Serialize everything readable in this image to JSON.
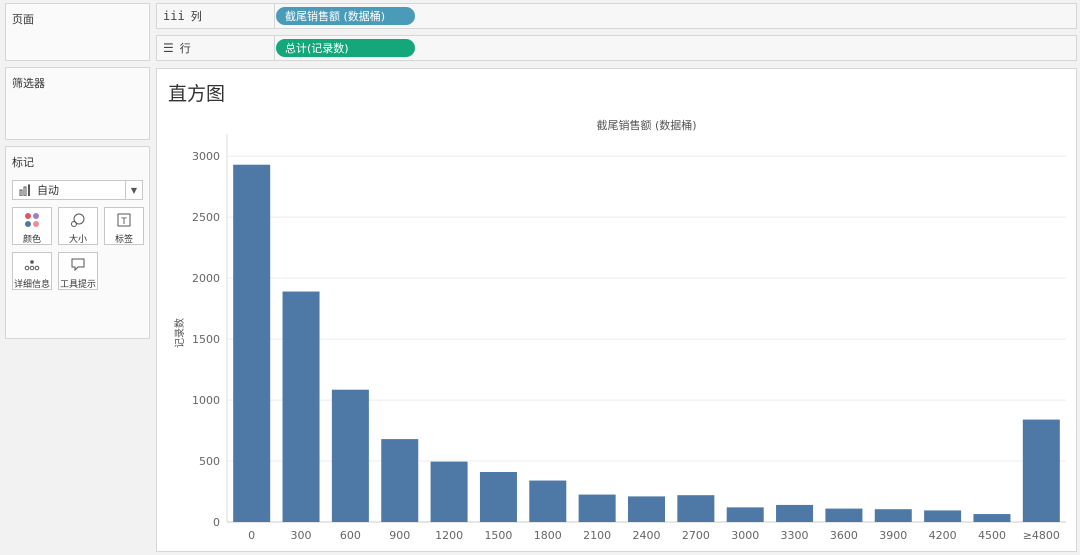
{
  "panels": {
    "pages": "页面",
    "filters": "筛选器",
    "marks": "标记"
  },
  "shelves": {
    "columns": {
      "icon": "iii",
      "label": "列",
      "pill": "截尾销售额 (数据桶)",
      "pill_color": "#4a9bb7"
    },
    "rows": {
      "icon": "☰",
      "label": "行",
      "pill": "总计(记录数)",
      "pill_color": "#14a77a"
    }
  },
  "marks_card": {
    "type": "自动",
    "buttons": [
      {
        "label": "颜色",
        "icon": "color-icon"
      },
      {
        "label": "大小",
        "icon": "size-icon"
      },
      {
        "label": "标签",
        "icon": "label-icon"
      },
      {
        "label": "详细信息",
        "icon": "detail-icon"
      },
      {
        "label": "工具提示",
        "icon": "tooltip-icon"
      }
    ]
  },
  "sheet_title": "直方图",
  "chart_data": {
    "type": "bar",
    "title": "截尾销售额 (数据桶)",
    "xlabel": "",
    "ylabel": "记录数",
    "categories": [
      "0",
      "300",
      "600",
      "900",
      "1200",
      "1500",
      "1800",
      "2100",
      "2400",
      "2700",
      "3000",
      "3300",
      "3600",
      "3900",
      "4200",
      "4500",
      "≥4800"
    ],
    "values": [
      2930,
      1890,
      1085,
      680,
      495,
      410,
      340,
      225,
      210,
      220,
      120,
      140,
      110,
      105,
      95,
      65,
      840
    ],
    "yticks": [
      "0",
      "500",
      "1000",
      "1500",
      "2000",
      "2500",
      "3000"
    ],
    "ylim": [
      0,
      3100
    ],
    "grid": true,
    "bar_color": "#4e79a7"
  }
}
